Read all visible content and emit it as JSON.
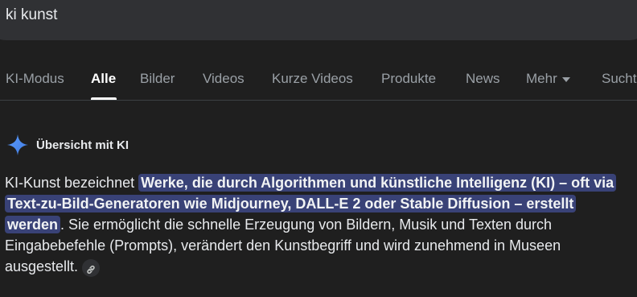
{
  "search": {
    "query": "ki kunst"
  },
  "tabs": [
    {
      "label": "KI-Modus"
    },
    {
      "label": "Alle"
    },
    {
      "label": "Bilder"
    },
    {
      "label": "Videos"
    },
    {
      "label": "Kurze Videos"
    },
    {
      "label": "Produkte"
    },
    {
      "label": "News"
    },
    {
      "label": "Mehr"
    },
    {
      "label": "Suchti"
    }
  ],
  "active_tab": "Alle",
  "ai_overview": {
    "title": "Übersicht mit KI",
    "text_intro": "KI-Kunst bezeichnet ",
    "text_highlight": "Werke, die durch Algorithmen und künstliche Intelligenz (KI) – oft via Text-zu-Bild-Generatoren wie Midjourney, DALL-E 2 oder Stable Diffusion – erstellt werden",
    "text_rest": ". Sie ermöglicht die schnelle Erzeugung von Bildern, Musik und Texten durch Eingabebefehle (Prompts), verändert den Kunstbegriff und wird zunehmend in Museen ausgestellt."
  },
  "icons": [
    "sparkle-icon",
    "chevron-down-icon",
    "link-icon"
  ],
  "colors": {
    "background": "#1f1f1f",
    "search_bar": "#303134",
    "highlight": "#394277",
    "spark_blue": "#4f8df5"
  }
}
